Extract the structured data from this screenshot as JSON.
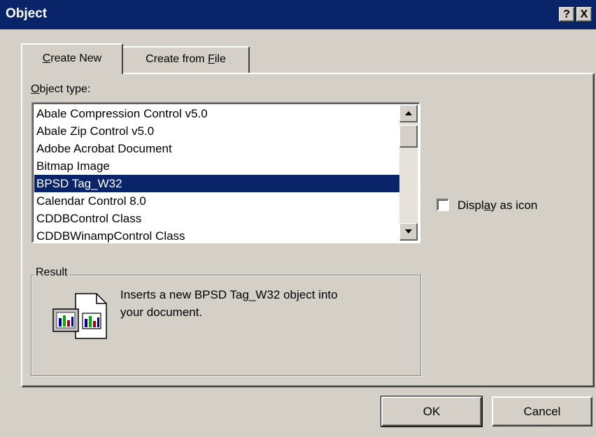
{
  "window": {
    "title": "Object",
    "help_button": "?",
    "close_button": "X"
  },
  "tabs": {
    "create_new": {
      "pre": "",
      "ul": "C",
      "post": "reate New"
    },
    "create_from_file": {
      "pre": "Create from ",
      "ul": "F",
      "post": "ile"
    }
  },
  "object_type_label": {
    "pre": "",
    "ul": "O",
    "post": "bject type:"
  },
  "object_types": [
    "Abale Compression Control v5.0",
    "Abale Zip Control v5.0",
    "Adobe Acrobat Document",
    "Bitmap Image",
    "BPSD Tag_W32",
    "Calendar Control 8.0",
    "CDDBControl Class",
    "CDDBWinampControl Class"
  ],
  "selected_index": 4,
  "display_as_icon": {
    "pre": "Displ",
    "ul": "a",
    "post": "y as icon",
    "checked": false
  },
  "result": {
    "title": "Result",
    "text_line1": "Inserts a new BPSD Tag_W32  object into",
    "text_line2": "your document."
  },
  "buttons": {
    "ok": "OK",
    "cancel": "Cancel"
  },
  "icons": {
    "scroll_up": "scroll-up-arrow-icon",
    "scroll_down": "scroll-down-arrow-icon",
    "result": "embedded-object-icon"
  },
  "colors": {
    "titlebar": "#0a246a",
    "selection": "#0a246a",
    "face": "#d4d0c8"
  }
}
